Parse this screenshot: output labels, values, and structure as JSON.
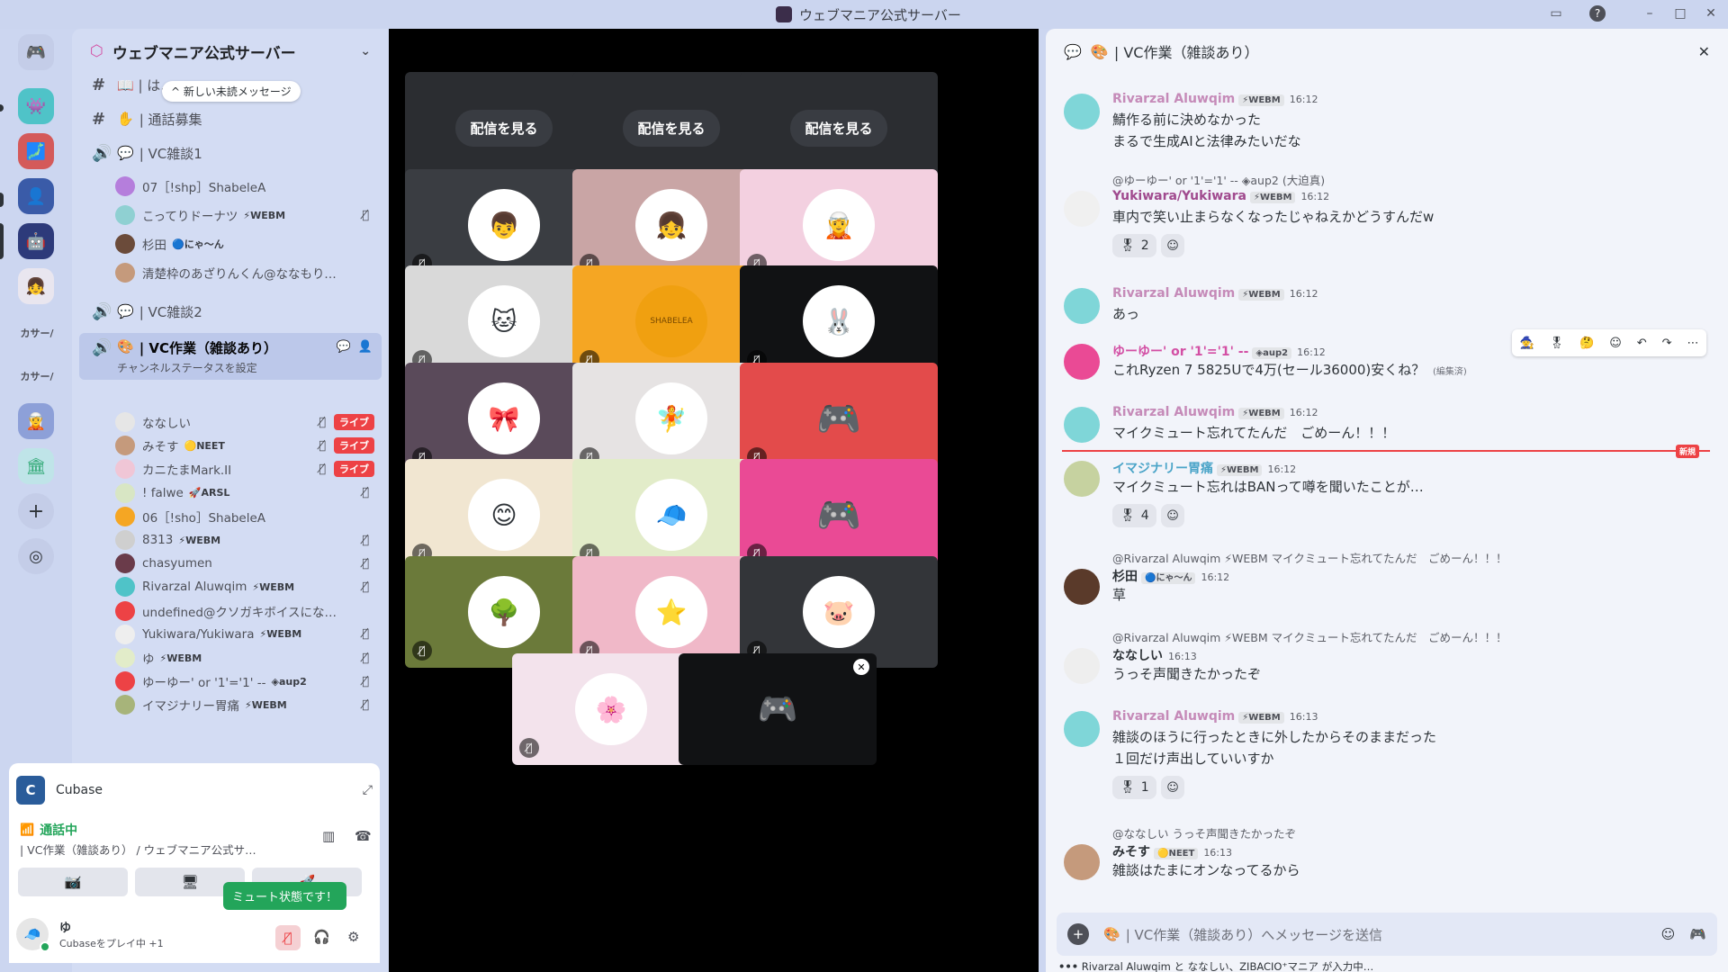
{
  "window": {
    "title": "ウェブマニア公式サーバー",
    "icons": [
      "inbox-icon",
      "help-icon",
      "minimize-icon",
      "maximize-icon",
      "close-icon"
    ]
  },
  "rail": {
    "text_items": [
      "カサー/",
      "カサー/"
    ]
  },
  "server": {
    "name": "ウェブマニア公式サーバー",
    "unread_pill": "^ 新しい未読メッセージ",
    "channels": [
      {
        "type": "text",
        "label": "📖 | は…"
      },
      {
        "type": "text",
        "label": "| 通話募集"
      },
      {
        "type": "voice",
        "label": "| VC雑談1"
      },
      {
        "type": "voice",
        "label": "| VC雑談2"
      },
      {
        "type": "voice",
        "label": "| VC作業（雑談あり）",
        "status": "チャンネルステータスを設定"
      }
    ],
    "vc1_users": [
      {
        "name": "07［!shp］ShabeleA",
        "tag": ""
      },
      {
        "name": "こってりドーナツ",
        "tag": "⚡WEBM"
      },
      {
        "name": "杉田",
        "tag": "🔵にゃ〜ん"
      },
      {
        "name": "清楚枠のあざりんくん@ななもり。…",
        "tag": ""
      }
    ],
    "vc_work_users": [
      {
        "name": "ななしい",
        "tag": "",
        "live": "ライブ"
      },
      {
        "name": "みそす",
        "tag": "🟡NEET",
        "live": "ライブ"
      },
      {
        "name": "カニたまMark.II",
        "tag": "",
        "live": "ライブ"
      },
      {
        "name": "! falwe",
        "tag": "🚀ARSL"
      },
      {
        "name": "06［!sho］ShabeleA",
        "tag": ""
      },
      {
        "name": "8313",
        "tag": "⚡WEBM"
      },
      {
        "name": "chasyumen",
        "tag": ""
      },
      {
        "name": "Rivarzal Aluwqim",
        "tag": "⚡WEBM"
      },
      {
        "name": "undefined@クソガキボイスになっ…",
        "tag": ""
      },
      {
        "name": "Yukiwara/Yukiwara",
        "tag": "⚡WEBM"
      },
      {
        "name": "ゆ",
        "tag": "⚡WEBM"
      },
      {
        "name": "ゆーゆー' or '1'='1' --",
        "tag": "◈aup2"
      },
      {
        "name": "イマジナリー胃痛",
        "tag": "⚡WEBM"
      }
    ]
  },
  "panel": {
    "activity": "Cubase",
    "voice_status": "通話中",
    "voice_channel": "| VC作業（雑談あり） / ウェブマニア公式サ…",
    "toast": "ミュート状態です！",
    "user_name": "ゆ",
    "user_status": "Cubaseをプレイ中 +1"
  },
  "stage": {
    "watch_label": "配信を見る",
    "tile_colors": [
      "#3a3d42",
      "#c9a5a5",
      "#f3d0e0",
      "#d9d9d9",
      "#f5a623",
      "#111214",
      "#5a4a5a",
      "#e6e3e3",
      "#e34b4b",
      "#f1e6d1",
      "#e2ecc9",
      "#ea4a95",
      "#6b7a3a",
      "#f0b8c8",
      "#333539",
      "#f3e3ec"
    ],
    "tile_center_text": "SHABELEA"
  },
  "chat": {
    "channel": "| VC作業（雑談あり）",
    "input_placeholder": "| VC作業（雑談あり）へメッセージを送信",
    "typing": "Rivarzal Aluwqim と ななしい、ZIBACIO⁺マニア が入力中…",
    "new_label": "新規",
    "messages": [
      {
        "user": "Rivarzal Aluwqim",
        "badge": "⚡WEBM",
        "time": "16:12",
        "lines": [
          "鯖作る前に決めなかった",
          "まるで生成AIと法律みたいだな"
        ]
      },
      {
        "reply": "@ゆーゆー' or '1'='1' -- ◈aup2 (大迫真)",
        "user": "Yukiwara/Yukiwara",
        "badge": "⚡WEBM",
        "time": "16:12",
        "lines": [
          "車内で笑い止まらなくなったじゃねえかどうすんだw"
        ],
        "reaction": "2"
      },
      {
        "user": "Rivarzal Aluwqim",
        "badge": "⚡WEBM",
        "time": "16:12",
        "lines": [
          "あっ"
        ]
      },
      {
        "user": "ゆーゆー' or '1'='1' --",
        "badge": "◈aup2",
        "time": "16:12",
        "lines": [
          "これRyzen 7 5825Uで4万(セール36000)安くね？"
        ],
        "edited": "(編集済)"
      },
      {
        "user": "Rivarzal Aluwqim",
        "badge": "⚡WEBM",
        "time": "16:12",
        "lines": [
          "マイクミュート忘れてたんだ　ごめーん！！！"
        ]
      },
      {
        "user": "イマジナリー胃痛",
        "badge": "⚡WEBM",
        "time": "16:12",
        "lines": [
          "マイクミュート忘れはBANって噂を聞いたことが…"
        ],
        "reaction": "4"
      },
      {
        "reply": "@Rivarzal Aluwqim ⚡WEBM マイクミュート忘れてたんだ　ごめーん！！！",
        "user": "杉田",
        "badge": "🔵にゃ〜ん",
        "time": "16:12",
        "lines": [
          "草"
        ]
      },
      {
        "reply": "@Rivarzal Aluwqim ⚡WEBM マイクミュート忘れてたんだ　ごめーん！！！",
        "user": "ななしい",
        "badge": "",
        "time": "16:13",
        "lines": [
          "うっそ声聞きたかったぞ"
        ]
      },
      {
        "user": "Rivarzal Aluwqim",
        "badge": "⚡WEBM",
        "time": "16:13",
        "lines": [
          "雑談のほうに行ったときに外したからそのままだった",
          "１回だけ声出していいすか"
        ],
        "reaction": "1"
      },
      {
        "reply": "@ななしい うっそ声聞きたかったぞ",
        "user": "みそす",
        "badge": "🟡NEET",
        "time": "16:13",
        "lines": [
          "雑談はたまにオンなってるから"
        ]
      }
    ]
  },
  "colors": {
    "accent": "#5865f2",
    "live": "#ed4245",
    "green": "#23a55a",
    "pink_name": "#d34fa4"
  }
}
